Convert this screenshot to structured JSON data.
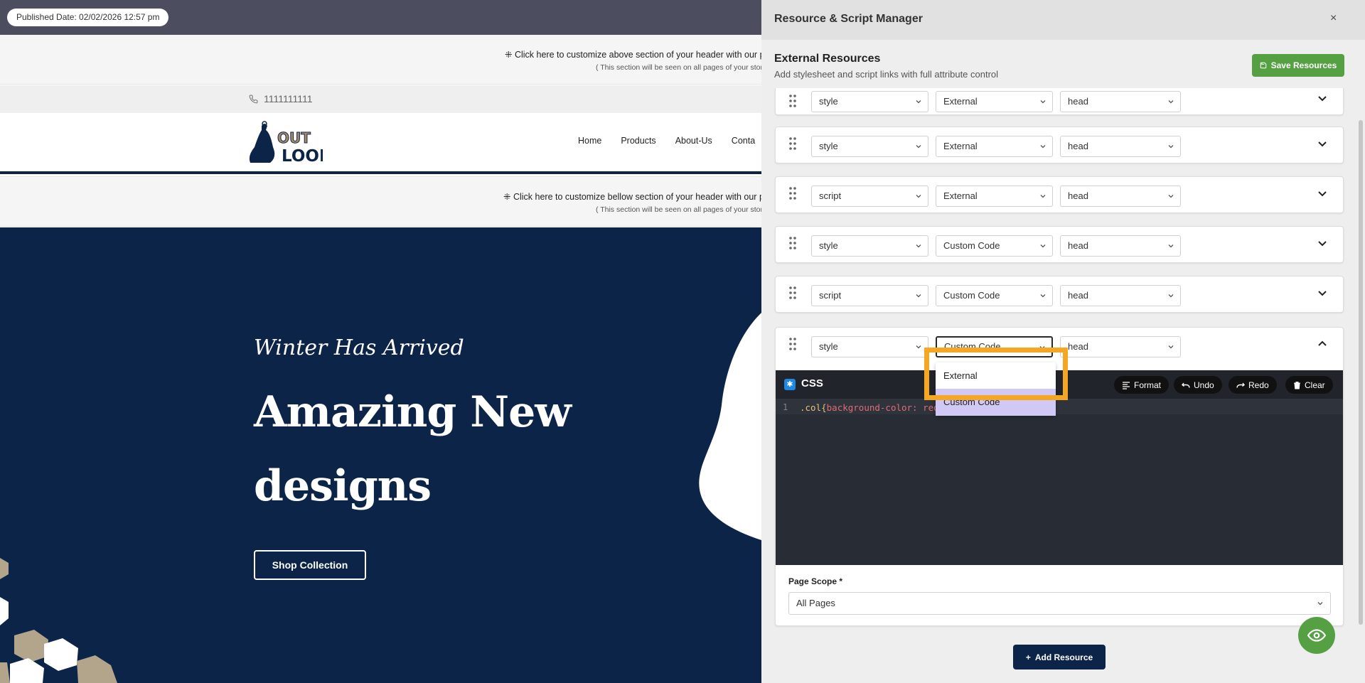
{
  "store": {
    "published_date": "Published Date: 02/02/2026 12:57 pm",
    "strip_top_line1": "⁜ Click here to customize above section of your header with our po",
    "strip_top_line2": "( This section will be seen on all pages of your store",
    "phone": "1111111111",
    "logo_text_top": "OUT",
    "logo_text_bottom": "LOOK",
    "nav": [
      "Home",
      "Products",
      "About-Us",
      "Conta"
    ],
    "strip_bottom_line1": "⁜ Click here to customize bellow section of your header with our p",
    "strip_bottom_line2": "( This section will be seen on all pages of your store",
    "hero_script": "Winter Has Arrived",
    "hero_title": "Amazing New designs",
    "shop_button": "Shop Collection"
  },
  "panel": {
    "title": "Resource & Script Manager",
    "close": "×",
    "section_title": "External Resources",
    "section_subtitle": "Add stylesheet and script links with full attribute control",
    "save_button": "Save Resources",
    "rows": [
      {
        "type": "style",
        "source": "External",
        "position": "head"
      },
      {
        "type": "style",
        "source": "External",
        "position": "head"
      },
      {
        "type": "script",
        "source": "External",
        "position": "head"
      },
      {
        "type": "style",
        "source": "Custom Code",
        "position": "head"
      },
      {
        "type": "script",
        "source": "Custom Code",
        "position": "head"
      }
    ],
    "expanded_row": {
      "type": "style",
      "source": "Custom Code",
      "position": "head"
    },
    "editor": {
      "language": "CSS",
      "buttons": {
        "format": "Format",
        "undo": "Undo",
        "redo": "Redo",
        "clear": "Clear"
      },
      "line_number": "1",
      "code_selector": ".col{",
      "code_property": "background-color:",
      "code_value": " red"
    },
    "page_scope_label": "Page Scope *",
    "page_scope_value": "All Pages",
    "dropdown_options": [
      "External",
      "Custom Code"
    ],
    "add_button": "Add Resource"
  },
  "colors": {
    "accent_green": "#56a044",
    "navy": "#0c2447",
    "highlight_orange": "#f5a623",
    "option_hover": "#d0c8f5"
  }
}
